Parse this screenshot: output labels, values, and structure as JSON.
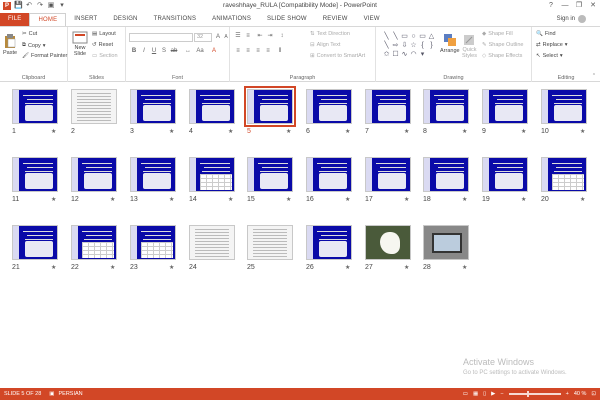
{
  "window": {
    "title": "raveshhaye_RULA [Compatibility Mode] - PowerPoint",
    "minimize": "—",
    "restore": "❐",
    "close": "✕",
    "help": "?"
  },
  "qat": {
    "app": "P",
    "save": "💾",
    "undo": "↶",
    "redo": "↷",
    "present": "▣",
    "customize": "▾"
  },
  "tabs": [
    "FILE",
    "HOME",
    "INSERT",
    "DESIGN",
    "TRANSITIONS",
    "ANIMATIONS",
    "SLIDE SHOW",
    "REVIEW",
    "VIEW"
  ],
  "active_tab": "HOME",
  "account": {
    "sign_in": "Sign in"
  },
  "ribbon": {
    "clipboard": {
      "paste": "Paste",
      "cut": "Cut",
      "copy": "Copy",
      "format_painter": "Format Painter",
      "group": "Clipboard"
    },
    "slides": {
      "new_slide": "New",
      "new_slide2": "Slide",
      "layout": "Layout",
      "reset": "Reset",
      "section": "Section",
      "group": "Slides"
    },
    "font": {
      "size": "32",
      "group": "Font"
    },
    "paragraph": {
      "text_direction": "Text Direction",
      "align_text": "Align Text",
      "convert_smartart": "Convert to SmartArt",
      "group": "Paragraph"
    },
    "drawing": {
      "arrange": "Arrange",
      "quick_styles": "Quick",
      "quick_styles2": "Styles",
      "shape_fill": "Shape Fill",
      "shape_outline": "Shape Outline",
      "shape_effects": "Shape Effects",
      "group": "Drawing"
    },
    "editing": {
      "find": "Find",
      "replace": "Replace",
      "select": "Select",
      "group": "Editing"
    }
  },
  "slides": [
    {
      "n": "1",
      "star": true
    },
    {
      "n": "2",
      "star": false
    },
    {
      "n": "3",
      "star": true
    },
    {
      "n": "4",
      "star": true
    },
    {
      "n": "5",
      "star": true
    },
    {
      "n": "6",
      "star": true
    },
    {
      "n": "7",
      "star": true
    },
    {
      "n": "8",
      "star": true
    },
    {
      "n": "9",
      "star": true
    },
    {
      "n": "10",
      "star": true
    },
    {
      "n": "11",
      "star": true
    },
    {
      "n": "12",
      "star": true
    },
    {
      "n": "13",
      "star": true
    },
    {
      "n": "14",
      "star": true
    },
    {
      "n": "15",
      "star": true
    },
    {
      "n": "16",
      "star": true
    },
    {
      "n": "17",
      "star": true
    },
    {
      "n": "18",
      "star": true
    },
    {
      "n": "19",
      "star": true
    },
    {
      "n": "20",
      "star": true
    },
    {
      "n": "21",
      "star": true
    },
    {
      "n": "22",
      "star": true
    },
    {
      "n": "23",
      "star": true
    },
    {
      "n": "24",
      "star": false
    },
    {
      "n": "25",
      "star": false
    },
    {
      "n": "26",
      "star": true
    },
    {
      "n": "27",
      "star": true
    },
    {
      "n": "28",
      "star": true
    }
  ],
  "star_glyph": "★",
  "selected_slide": "5",
  "watermark": {
    "line1": "Activate Windows",
    "line2": "Go to PC settings to activate Windows."
  },
  "status": {
    "slide_info": "SLIDE 5 OF 28",
    "language": "PERSIAN",
    "zoom": "40 %",
    "zoom_out": "−",
    "zoom_in": "+"
  },
  "colors": {
    "accent": "#d24726",
    "slide_bg": "#0a0aa8"
  }
}
